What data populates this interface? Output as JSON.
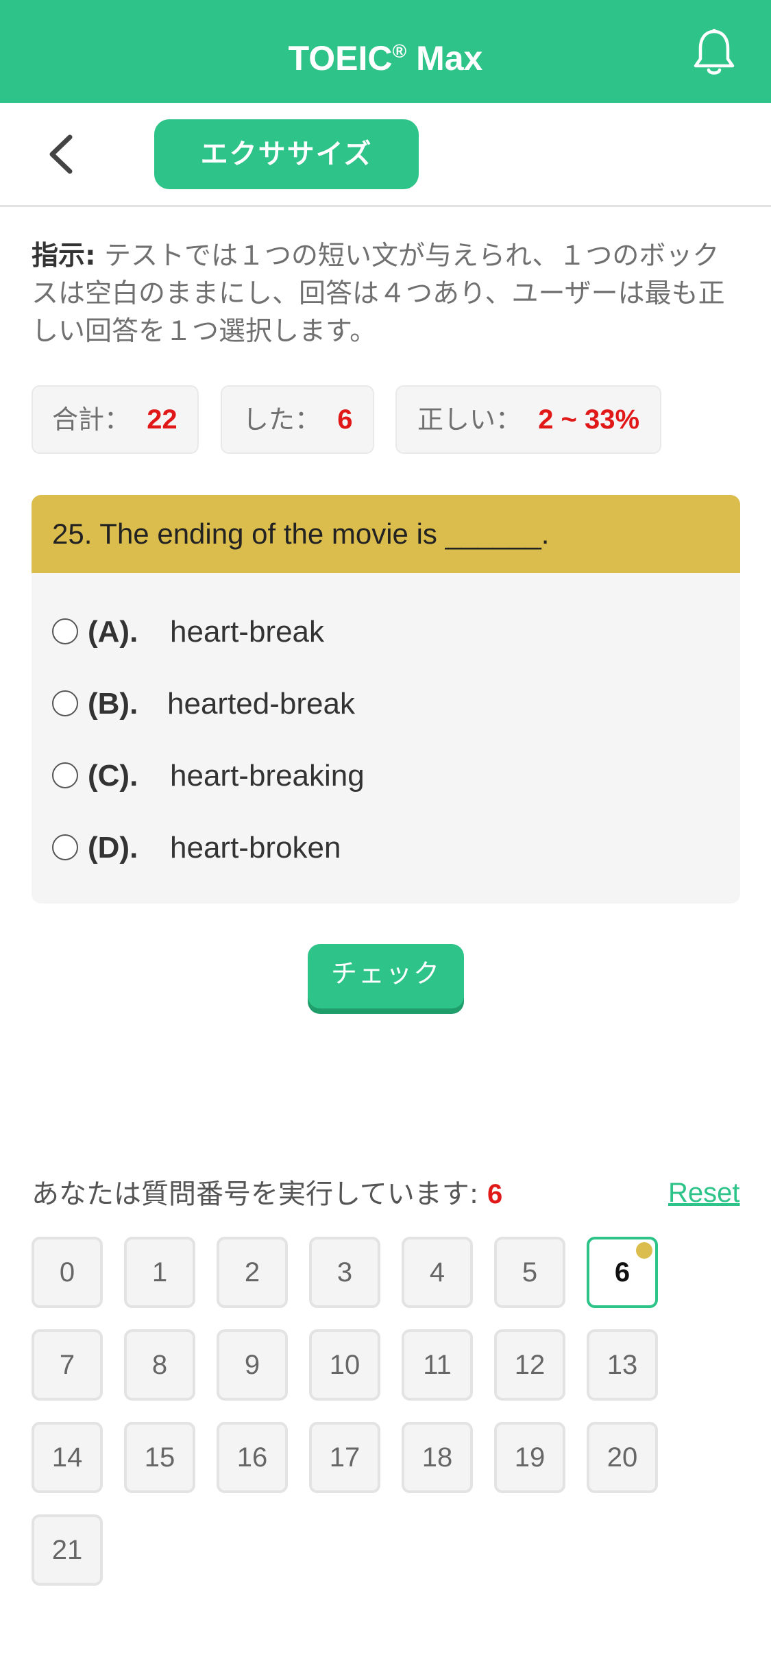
{
  "header": {
    "title": "TOEIC",
    "reg_mark": "®",
    "title_suffix": " Max",
    "bell_icon": "bell-icon"
  },
  "subbar": {
    "back_icon": "chevron-left-icon",
    "tab_label": "エクササイズ"
  },
  "instruction": {
    "label": "指示:",
    "text": " テストでは１つの短い文が与えられ、１つのボックスは空白のままにし、回答は４つあり、ユーザーは最も正しい回答を１つ選択します。"
  },
  "stats": {
    "total_label": "合計：",
    "total_value": "22",
    "done_label": "した：",
    "done_value": "6",
    "correct_label": "正しい：",
    "correct_value": "2 ~ 33%"
  },
  "question": {
    "text": "25. The ending of the movie is ______.",
    "options": [
      {
        "key": "(A).",
        "text": "heart-break"
      },
      {
        "key": "(B).",
        "text": "hearted-break"
      },
      {
        "key": "(C).",
        "text": "heart-breaking"
      },
      {
        "key": "(D).",
        "text": "heart-broken"
      }
    ]
  },
  "check_label": "チェック",
  "progress": {
    "label": "あなたは質問番号を実行しています: ",
    "current": "6",
    "reset_label": "Reset"
  },
  "grid": {
    "numbers": [
      "0",
      "1",
      "2",
      "3",
      "4",
      "5",
      "6",
      "7",
      "8",
      "9",
      "10",
      "11",
      "12",
      "13",
      "14",
      "15",
      "16",
      "17",
      "18",
      "19",
      "20",
      "21"
    ],
    "active": "6"
  },
  "colors": {
    "accent": "#2ec489",
    "question_bar": "#dbbd4d",
    "highlight": "#e01818"
  }
}
